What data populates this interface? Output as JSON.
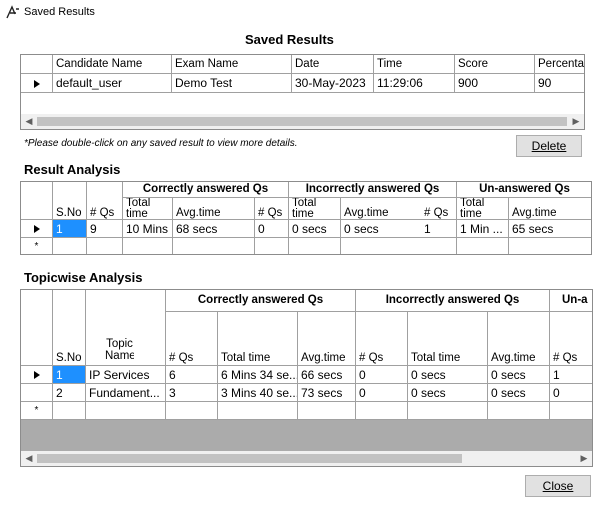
{
  "window": {
    "title": "Saved Results"
  },
  "saved_results": {
    "heading": "Saved Results",
    "columns": [
      "Candidate Name",
      "Exam Name",
      "Date",
      "Time",
      "Score",
      "Percenta"
    ],
    "rows": [
      [
        "default_user",
        "Demo Test",
        "30-May-2023",
        "11:29:06",
        "900",
        "90"
      ]
    ]
  },
  "note": "*Please double-click on any saved result to view  more details.",
  "delete_button": "Delete",
  "result_analysis": {
    "heading": "Result Analysis",
    "groups": [
      "Correctly answered Qs",
      "Incorrectly answered Qs",
      "Un-answered Qs"
    ],
    "columns": [
      "S.No",
      "# Qs",
      "Total time",
      "Avg.time",
      "# Qs",
      "Total time",
      "Avg.time",
      "# Qs",
      "Total time",
      "Avg.time"
    ],
    "rows": [
      [
        "1",
        "9",
        "10 Mins ...",
        "68 secs",
        "0",
        "0 secs",
        "0 secs",
        "1",
        "1 Min ...",
        "65 secs"
      ]
    ],
    "new_row_marker": "*"
  },
  "topicwise_analysis": {
    "heading": "Topicwise Analysis",
    "groups": [
      "Correctly answered Qs",
      "Incorrectly answered Qs",
      "Un-a"
    ],
    "columns": [
      "S.No",
      "Topic Name",
      "# Qs",
      "Total time",
      "Avg.time",
      "# Qs",
      "Total time",
      "Avg.time",
      "# Qs"
    ],
    "rows": [
      [
        "1",
        "IP Services",
        "6",
        "6 Mins 34 se...",
        "66 secs",
        "0",
        "0 secs",
        "0 secs",
        "1"
      ],
      [
        "2",
        "Fundament...",
        "3",
        "3 Mins 40 se...",
        "73 secs",
        "0",
        "0 secs",
        "0 secs",
        "0"
      ]
    ],
    "new_row_marker": "*"
  },
  "close_button": "Close",
  "icons": {
    "app": "app-logo-icon",
    "row_pointer": "row-pointer-icon",
    "scroll_left": "chevron-left-icon",
    "scroll_right": "chevron-right-icon"
  }
}
